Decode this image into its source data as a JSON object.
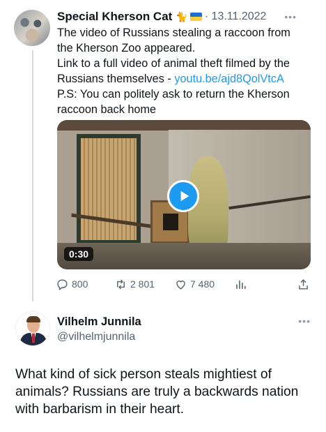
{
  "tweet1": {
    "author_name": "Special Kherson Cat",
    "author_emoji": "🐈",
    "flag": "ukraine-flag",
    "date": "· 13.11.2022",
    "more_icon": "•••",
    "text_lines": [
      "The video of Russians stealing a raccoon from",
      "the Kherson Zoo appeared.",
      "Link to a full video of animal theft filmed by the",
      "Russians themselves - "
    ],
    "link_text": "youtu.be/ajd8QolVtcA",
    "text_lines_after": [
      "P.S: You can politely ask to return the Kherson",
      "raccoon back home"
    ],
    "video": {
      "duration": "0:30"
    },
    "actions": {
      "replies": "800",
      "retweets": "2 801",
      "likes": "7 480"
    }
  },
  "tweet2": {
    "author_name": "Vilhelm Junnila",
    "handle": "@vilhelmjunnila",
    "more_icon": "•••",
    "text_lines": [
      "What kind of sick person steals mightiest of",
      "animals? Russians are truly a backwards nation",
      "with barbarism in their heart."
    ]
  },
  "colors": {
    "accent": "#1d9bf0",
    "secondary_text": "#536471",
    "thread_line": "#cfd9de"
  }
}
